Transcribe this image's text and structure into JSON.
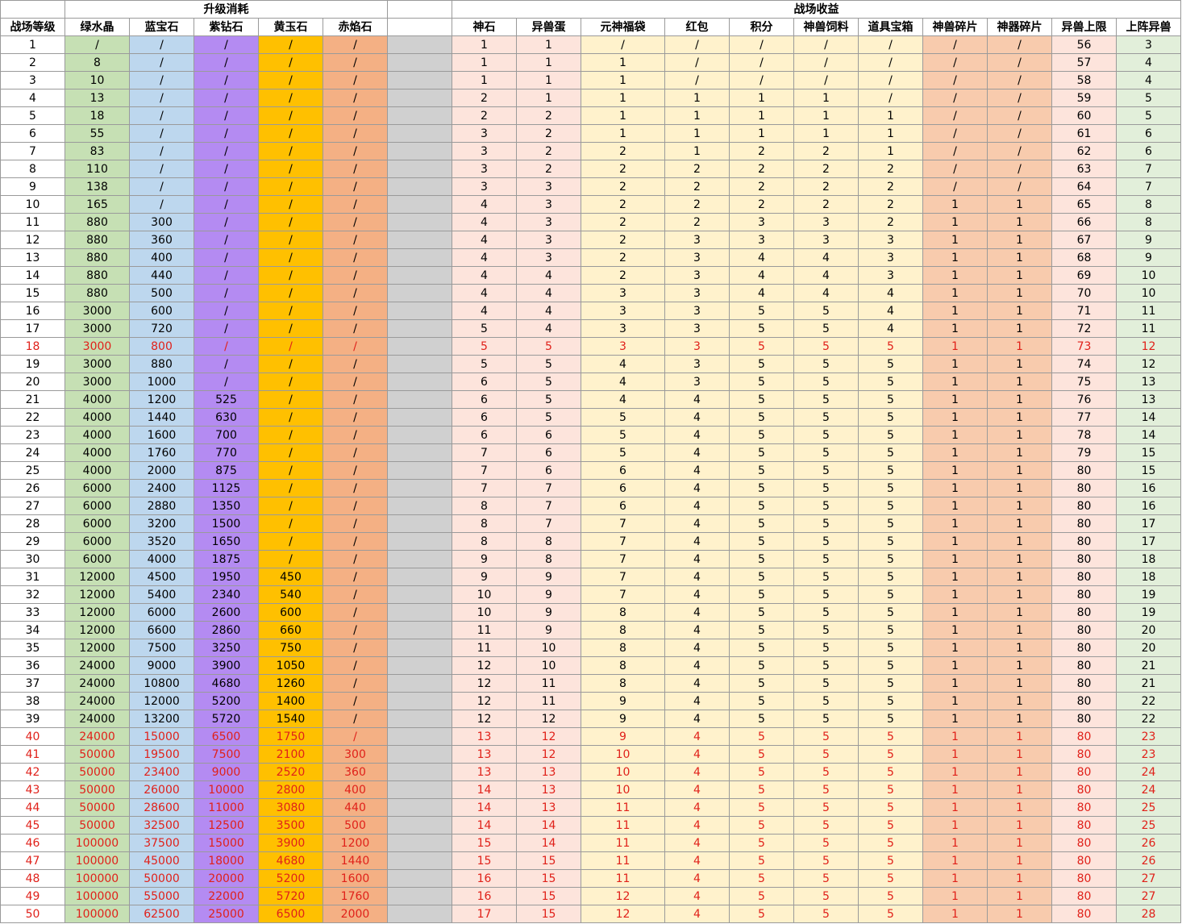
{
  "groups": [
    {
      "label": "",
      "span": 1
    },
    {
      "label": "升级消耗",
      "span": 5
    },
    {
      "label": "",
      "span": 1
    },
    {
      "label": "战场收益",
      "span": 11
    }
  ],
  "columns": [
    "战场等级",
    "绿水晶",
    "蓝宝石",
    "紫钻石",
    "黄玉石",
    "赤焰石",
    "",
    "神石",
    "异兽蛋",
    "元神福袋",
    "红包",
    "积分",
    "神兽饲料",
    "道具宝箱",
    "神兽碎片",
    "神器碎片",
    "异兽上限",
    "上阵异兽"
  ],
  "column_fills": [
    "#ffffff",
    "#c6e0b4",
    "#bdd7ee",
    "#b48bf2",
    "#ffc000",
    "#f4b084",
    "#d0d0d0",
    "#fde4dc",
    "#fde4dc",
    "#fff2cc",
    "#fff2cc",
    "#fff2cc",
    "#fff2cc",
    "#fff2cc",
    "#f8cbad",
    "#f8cbad",
    "#fde4dc",
    "#e2efda"
  ],
  "highlight_color": "#e0211a",
  "rows": [
    {
      "c": [
        "1",
        "/",
        "/",
        "/",
        "/",
        "/",
        "",
        "1",
        "1",
        "/",
        "/",
        "/",
        "/",
        "/",
        "/",
        "/",
        "56",
        "3"
      ]
    },
    {
      "c": [
        "2",
        "8",
        "/",
        "/",
        "/",
        "/",
        "",
        "1",
        "1",
        "1",
        "/",
        "/",
        "/",
        "/",
        "/",
        "/",
        "57",
        "4"
      ]
    },
    {
      "c": [
        "3",
        "10",
        "/",
        "/",
        "/",
        "/",
        "",
        "1",
        "1",
        "1",
        "/",
        "/",
        "/",
        "/",
        "/",
        "/",
        "58",
        "4"
      ]
    },
    {
      "c": [
        "4",
        "13",
        "/",
        "/",
        "/",
        "/",
        "",
        "2",
        "1",
        "1",
        "1",
        "1",
        "1",
        "/",
        "/",
        "/",
        "59",
        "5"
      ]
    },
    {
      "c": [
        "5",
        "18",
        "/",
        "/",
        "/",
        "/",
        "",
        "2",
        "2",
        "1",
        "1",
        "1",
        "1",
        "1",
        "/",
        "/",
        "60",
        "5"
      ]
    },
    {
      "c": [
        "6",
        "55",
        "/",
        "/",
        "/",
        "/",
        "",
        "3",
        "2",
        "1",
        "1",
        "1",
        "1",
        "1",
        "/",
        "/",
        "61",
        "6"
      ]
    },
    {
      "c": [
        "7",
        "83",
        "/",
        "/",
        "/",
        "/",
        "",
        "3",
        "2",
        "2",
        "1",
        "2",
        "2",
        "1",
        "/",
        "/",
        "62",
        "6"
      ]
    },
    {
      "c": [
        "8",
        "110",
        "/",
        "/",
        "/",
        "/",
        "",
        "3",
        "2",
        "2",
        "2",
        "2",
        "2",
        "2",
        "/",
        "/",
        "63",
        "7"
      ]
    },
    {
      "c": [
        "9",
        "138",
        "/",
        "/",
        "/",
        "/",
        "",
        "3",
        "3",
        "2",
        "2",
        "2",
        "2",
        "2",
        "/",
        "/",
        "64",
        "7"
      ]
    },
    {
      "c": [
        "10",
        "165",
        "/",
        "/",
        "/",
        "/",
        "",
        "4",
        "3",
        "2",
        "2",
        "2",
        "2",
        "2",
        "1",
        "1",
        "65",
        "8"
      ]
    },
    {
      "c": [
        "11",
        "880",
        "300",
        "/",
        "/",
        "/",
        "",
        "4",
        "3",
        "2",
        "2",
        "3",
        "3",
        "2",
        "1",
        "1",
        "66",
        "8"
      ]
    },
    {
      "c": [
        "12",
        "880",
        "360",
        "/",
        "/",
        "/",
        "",
        "4",
        "3",
        "2",
        "3",
        "3",
        "3",
        "3",
        "1",
        "1",
        "67",
        "9"
      ]
    },
    {
      "c": [
        "13",
        "880",
        "400",
        "/",
        "/",
        "/",
        "",
        "4",
        "3",
        "2",
        "3",
        "4",
        "4",
        "3",
        "1",
        "1",
        "68",
        "9"
      ]
    },
    {
      "c": [
        "14",
        "880",
        "440",
        "/",
        "/",
        "/",
        "",
        "4",
        "4",
        "2",
        "3",
        "4",
        "4",
        "3",
        "1",
        "1",
        "69",
        "10"
      ]
    },
    {
      "c": [
        "15",
        "880",
        "500",
        "/",
        "/",
        "/",
        "",
        "4",
        "4",
        "3",
        "3",
        "4",
        "4",
        "4",
        "1",
        "1",
        "70",
        "10"
      ]
    },
    {
      "c": [
        "16",
        "3000",
        "600",
        "/",
        "/",
        "/",
        "",
        "4",
        "4",
        "3",
        "3",
        "5",
        "5",
        "4",
        "1",
        "1",
        "71",
        "11"
      ]
    },
    {
      "c": [
        "17",
        "3000",
        "720",
        "/",
        "/",
        "/",
        "",
        "5",
        "4",
        "3",
        "3",
        "5",
        "5",
        "4",
        "1",
        "1",
        "72",
        "11"
      ]
    },
    {
      "c": [
        "18",
        "3000",
        "800",
        "/",
        "/",
        "/",
        "",
        "5",
        "5",
        "3",
        "3",
        "5",
        "5",
        "5",
        "1",
        "1",
        "73",
        "12"
      ],
      "red": true
    },
    {
      "c": [
        "19",
        "3000",
        "880",
        "/",
        "/",
        "/",
        "",
        "5",
        "5",
        "4",
        "3",
        "5",
        "5",
        "5",
        "1",
        "1",
        "74",
        "12"
      ]
    },
    {
      "c": [
        "20",
        "3000",
        "1000",
        "/",
        "/",
        "/",
        "",
        "6",
        "5",
        "4",
        "3",
        "5",
        "5",
        "5",
        "1",
        "1",
        "75",
        "13"
      ]
    },
    {
      "c": [
        "21",
        "4000",
        "1200",
        "525",
        "/",
        "/",
        "",
        "6",
        "5",
        "4",
        "4",
        "5",
        "5",
        "5",
        "1",
        "1",
        "76",
        "13"
      ]
    },
    {
      "c": [
        "22",
        "4000",
        "1440",
        "630",
        "/",
        "/",
        "",
        "6",
        "5",
        "5",
        "4",
        "5",
        "5",
        "5",
        "1",
        "1",
        "77",
        "14"
      ]
    },
    {
      "c": [
        "23",
        "4000",
        "1600",
        "700",
        "/",
        "/",
        "",
        "6",
        "6",
        "5",
        "4",
        "5",
        "5",
        "5",
        "1",
        "1",
        "78",
        "14"
      ]
    },
    {
      "c": [
        "24",
        "4000",
        "1760",
        "770",
        "/",
        "/",
        "",
        "7",
        "6",
        "5",
        "4",
        "5",
        "5",
        "5",
        "1",
        "1",
        "79",
        "15"
      ]
    },
    {
      "c": [
        "25",
        "4000",
        "2000",
        "875",
        "/",
        "/",
        "",
        "7",
        "6",
        "6",
        "4",
        "5",
        "5",
        "5",
        "1",
        "1",
        "80",
        "15"
      ]
    },
    {
      "c": [
        "26",
        "6000",
        "2400",
        "1125",
        "/",
        "/",
        "",
        "7",
        "7",
        "6",
        "4",
        "5",
        "5",
        "5",
        "1",
        "1",
        "80",
        "16"
      ]
    },
    {
      "c": [
        "27",
        "6000",
        "2880",
        "1350",
        "/",
        "/",
        "",
        "8",
        "7",
        "6",
        "4",
        "5",
        "5",
        "5",
        "1",
        "1",
        "80",
        "16"
      ]
    },
    {
      "c": [
        "28",
        "6000",
        "3200",
        "1500",
        "/",
        "/",
        "",
        "8",
        "7",
        "7",
        "4",
        "5",
        "5",
        "5",
        "1",
        "1",
        "80",
        "17"
      ]
    },
    {
      "c": [
        "29",
        "6000",
        "3520",
        "1650",
        "/",
        "/",
        "",
        "8",
        "8",
        "7",
        "4",
        "5",
        "5",
        "5",
        "1",
        "1",
        "80",
        "17"
      ]
    },
    {
      "c": [
        "30",
        "6000",
        "4000",
        "1875",
        "/",
        "/",
        "",
        "9",
        "8",
        "7",
        "4",
        "5",
        "5",
        "5",
        "1",
        "1",
        "80",
        "18"
      ]
    },
    {
      "c": [
        "31",
        "12000",
        "4500",
        "1950",
        "450",
        "/",
        "",
        "9",
        "9",
        "7",
        "4",
        "5",
        "5",
        "5",
        "1",
        "1",
        "80",
        "18"
      ]
    },
    {
      "c": [
        "32",
        "12000",
        "5400",
        "2340",
        "540",
        "/",
        "",
        "10",
        "9",
        "7",
        "4",
        "5",
        "5",
        "5",
        "1",
        "1",
        "80",
        "19"
      ]
    },
    {
      "c": [
        "33",
        "12000",
        "6000",
        "2600",
        "600",
        "/",
        "",
        "10",
        "9",
        "8",
        "4",
        "5",
        "5",
        "5",
        "1",
        "1",
        "80",
        "19"
      ]
    },
    {
      "c": [
        "34",
        "12000",
        "6600",
        "2860",
        "660",
        "/",
        "",
        "11",
        "9",
        "8",
        "4",
        "5",
        "5",
        "5",
        "1",
        "1",
        "80",
        "20"
      ]
    },
    {
      "c": [
        "35",
        "12000",
        "7500",
        "3250",
        "750",
        "/",
        "",
        "11",
        "10",
        "8",
        "4",
        "5",
        "5",
        "5",
        "1",
        "1",
        "80",
        "20"
      ]
    },
    {
      "c": [
        "36",
        "24000",
        "9000",
        "3900",
        "1050",
        "/",
        "",
        "12",
        "10",
        "8",
        "4",
        "5",
        "5",
        "5",
        "1",
        "1",
        "80",
        "21"
      ]
    },
    {
      "c": [
        "37",
        "24000",
        "10800",
        "4680",
        "1260",
        "/",
        "",
        "12",
        "11",
        "8",
        "4",
        "5",
        "5",
        "5",
        "1",
        "1",
        "80",
        "21"
      ]
    },
    {
      "c": [
        "38",
        "24000",
        "12000",
        "5200",
        "1400",
        "/",
        "",
        "12",
        "11",
        "9",
        "4",
        "5",
        "5",
        "5",
        "1",
        "1",
        "80",
        "22"
      ]
    },
    {
      "c": [
        "39",
        "24000",
        "13200",
        "5720",
        "1540",
        "/",
        "",
        "12",
        "12",
        "9",
        "4",
        "5",
        "5",
        "5",
        "1",
        "1",
        "80",
        "22"
      ]
    },
    {
      "c": [
        "40",
        "24000",
        "15000",
        "6500",
        "1750",
        "/",
        "",
        "13",
        "12",
        "9",
        "4",
        "5",
        "5",
        "5",
        "1",
        "1",
        "80",
        "23"
      ],
      "red": true
    },
    {
      "c": [
        "41",
        "50000",
        "19500",
        "7500",
        "2100",
        "300",
        "",
        "13",
        "12",
        "10",
        "4",
        "5",
        "5",
        "5",
        "1",
        "1",
        "80",
        "23"
      ],
      "red": true
    },
    {
      "c": [
        "42",
        "50000",
        "23400",
        "9000",
        "2520",
        "360",
        "",
        "13",
        "13",
        "10",
        "4",
        "5",
        "5",
        "5",
        "1",
        "1",
        "80",
        "24"
      ],
      "red": true
    },
    {
      "c": [
        "43",
        "50000",
        "26000",
        "10000",
        "2800",
        "400",
        "",
        "14",
        "13",
        "10",
        "4",
        "5",
        "5",
        "5",
        "1",
        "1",
        "80",
        "24"
      ],
      "red": true
    },
    {
      "c": [
        "44",
        "50000",
        "28600",
        "11000",
        "3080",
        "440",
        "",
        "14",
        "13",
        "11",
        "4",
        "5",
        "5",
        "5",
        "1",
        "1",
        "80",
        "25"
      ],
      "red": true
    },
    {
      "c": [
        "45",
        "50000",
        "32500",
        "12500",
        "3500",
        "500",
        "",
        "14",
        "14",
        "11",
        "4",
        "5",
        "5",
        "5",
        "1",
        "1",
        "80",
        "25"
      ],
      "red": true
    },
    {
      "c": [
        "46",
        "100000",
        "37500",
        "15000",
        "3900",
        "1200",
        "",
        "15",
        "14",
        "11",
        "4",
        "5",
        "5",
        "5",
        "1",
        "1",
        "80",
        "26"
      ],
      "red": true
    },
    {
      "c": [
        "47",
        "100000",
        "45000",
        "18000",
        "4680",
        "1440",
        "",
        "15",
        "15",
        "11",
        "4",
        "5",
        "5",
        "5",
        "1",
        "1",
        "80",
        "26"
      ],
      "red": true
    },
    {
      "c": [
        "48",
        "100000",
        "50000",
        "20000",
        "5200",
        "1600",
        "",
        "16",
        "15",
        "11",
        "4",
        "5",
        "5",
        "5",
        "1",
        "1",
        "80",
        "27"
      ],
      "red": true
    },
    {
      "c": [
        "49",
        "100000",
        "55000",
        "22000",
        "5720",
        "1760",
        "",
        "16",
        "15",
        "12",
        "4",
        "5",
        "5",
        "5",
        "1",
        "1",
        "80",
        "27"
      ],
      "red": true
    },
    {
      "c": [
        "50",
        "100000",
        "62500",
        "25000",
        "6500",
        "2000",
        "",
        "17",
        "15",
        "12",
        "4",
        "5",
        "5",
        "5",
        "1",
        "1",
        "80",
        "28"
      ],
      "red": true
    }
  ]
}
